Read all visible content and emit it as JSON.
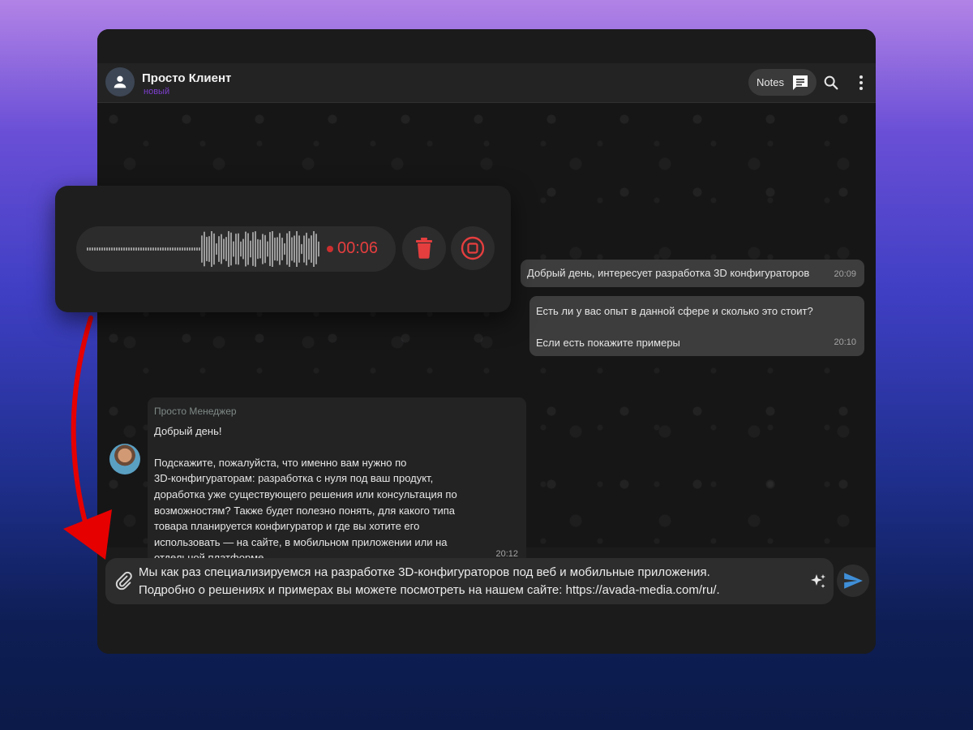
{
  "header": {
    "contact_name": "Просто Клиент",
    "contact_status": "новый",
    "notes_label": "Notes"
  },
  "messages": [
    {
      "direction": "out",
      "lines": [
        "Добрый день,  интересует разработка 3D конфигураторов"
      ],
      "time": "20:09"
    },
    {
      "direction": "out",
      "lines": [
        "Есть ли у вас опыт в данной сфере и сколько это стоит?",
        "",
        "Если есть покажите примеры"
      ],
      "time": "20:10"
    },
    {
      "direction": "in",
      "sender": "Просто Менеджер",
      "lines": [
        "Добрый день!",
        "",
        "Подскажите, пожалуйста, что именно вам нужно по",
        "3D-конфигураторам: разработка с нуля под ваш продукт,",
        "доработка уже существующего решения или консультация по",
        "возможностям? Также будет полезно понять, для какого типа",
        "товара планируется конфигуратор и где вы хотите его",
        "использовать — на сайте, в мобильном приложении или на",
        "отдельной платформе."
      ],
      "time": "20:12"
    }
  ],
  "composer": {
    "lines": [
      "Мы как раз специализируемся на разработке 3D-конфигураторов под веб и мобильные приложения.",
      "Подробно о решениях и примерах вы можете посмотреть на нашем сайте: https://avada-media.com/ru/."
    ]
  },
  "recorder": {
    "elapsed": "00:06"
  },
  "colors": {
    "accent_purple": "#7d3fcc",
    "record_red": "#e53e3e",
    "send_blue": "#3f8fd8",
    "arrow_red": "#e60000"
  },
  "icons": [
    "person-icon",
    "chat-bubble-icon",
    "search-icon",
    "more-vert-icon",
    "paperclip-icon",
    "sparkle-icon",
    "send-icon",
    "trash-icon",
    "stop-icon"
  ]
}
